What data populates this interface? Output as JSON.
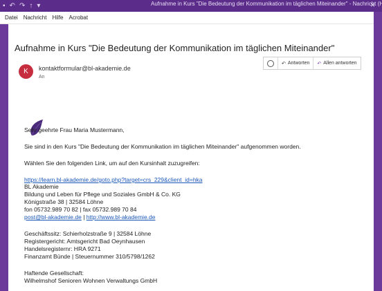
{
  "window": {
    "title": "Aufnahme in Kurs \"Die Bedeutung der Kommunikation im täglichen Miteinander\" - Nachricht (HTML)"
  },
  "menu": [
    "Datei",
    "Nachricht",
    "Hilfe",
    "Acrobat"
  ],
  "email": {
    "subject": "Aufnahme in Kurs \"Die Bedeutung der Kommunikation im täglichen Miteinander\"",
    "avatar_letter": "K",
    "avatar_color": "#c62d3e",
    "sender": "kontaktformular@bl-akademie.de",
    "to_label": "An",
    "actions": {
      "reply": "Antworten",
      "reply_all": "Allen antworten"
    },
    "greeting": "Sehr geehrte Frau Maria Mustermann,",
    "paragraph1": "Sie sind in den Kurs \"Die Bedeutung der Kommunikation im täglichen Miteinander\" aufgenommen worden.",
    "paragraph2": "Wählen Sie den folgenden Link, um auf den Kursinhalt zuzugreifen:",
    "course_link": "https://learn.bl-akademie.de/goto.php?target=crs_229&client_id=hka",
    "signature": {
      "line1": "BL Akademie",
      "line2": "Bildung und Leben für Pflege und Soziales GmbH & Co. KG",
      "line3": "Königstraße 38 | 32584 Löhne",
      "line4": "fon 05732.989 70 82 | fax 05732.989 70 84",
      "email": "post@bl-akademie.de",
      "separator": "|",
      "website": "http://www.bl-akademie.de"
    },
    "legal": {
      "line1": "Geschäftssitz: Schierholzstraße 9 | 32584 Löhne",
      "line2": "Registergericht: Amtsgericht Bad Oeynhausen",
      "line3": "Handelsregisternr: HRA 9271",
      "line4": "Finanzamt Bünde | Steuernummer 310/5798/1262"
    },
    "liability": {
      "line1": "Haftende Gesellschaft:",
      "line2": "Wilhelmshof Senioren Wohnen Verwaltungs GmbH"
    }
  },
  "colors": {
    "titlebar": "#5b2c8a",
    "link": "#1a56b8",
    "logo": "#4a2a7a"
  }
}
